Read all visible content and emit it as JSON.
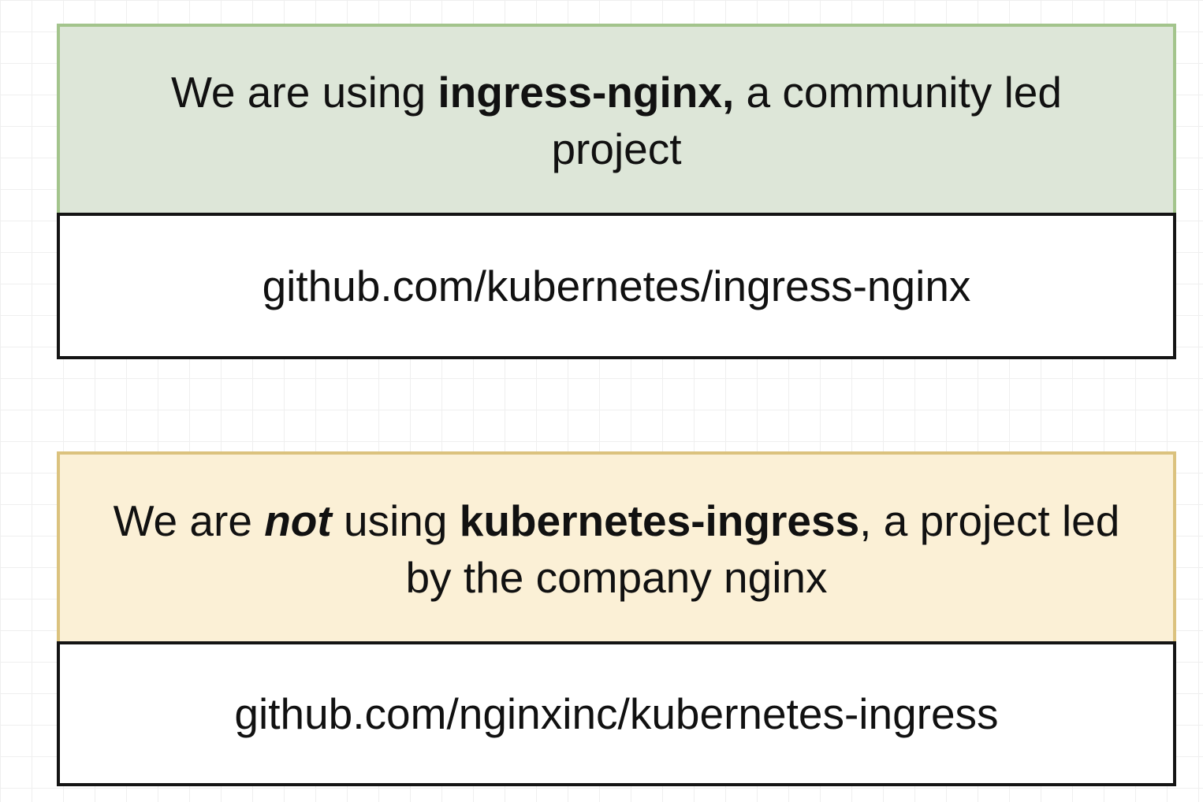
{
  "diagram": {
    "top_group": {
      "description": {
        "line1_prefix": "We are using ",
        "line1_bold": "ingress-nginx,",
        "line1_suffix": " a community led",
        "line2": "project"
      },
      "repo": "github.com/kubernetes/ingress-nginx",
      "fill_color": "#dde6d8",
      "border_color": "#a3c48c"
    },
    "bottom_group": {
      "description": {
        "line1_prefix": "We are ",
        "line1_italic_bold": "not",
        "line1_mid": " using ",
        "line1_bold": "kubernetes-ingress",
        "line1_suffix": ", a project led",
        "line2": "by the company nginx"
      },
      "repo": "github.com/nginxinc/kubernetes-ingress",
      "fill_color": "#fbf0d6",
      "border_color": "#dbc27e"
    }
  }
}
